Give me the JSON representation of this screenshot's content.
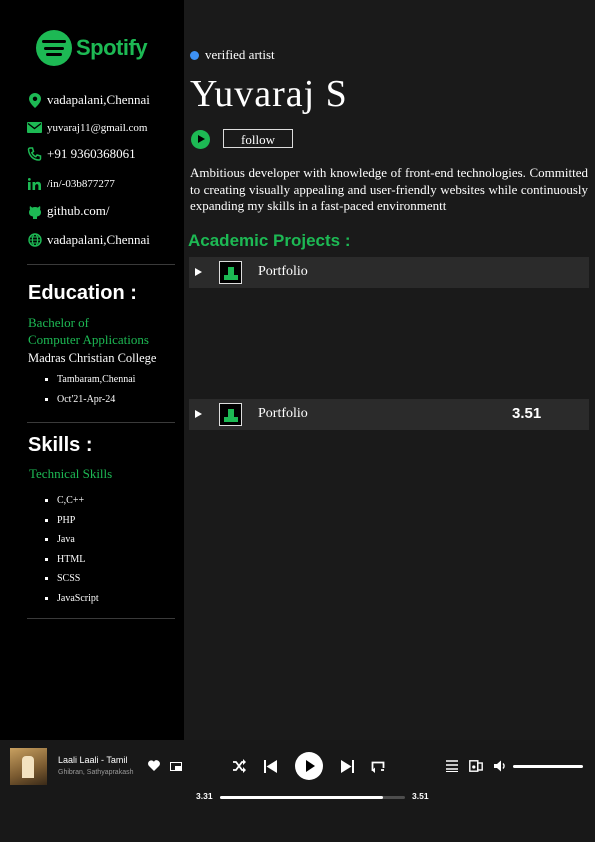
{
  "sidebar": {
    "logo_text": "Spotify",
    "contacts": [
      {
        "icon": "location-pin-icon",
        "text": "vadapalani,Chennai"
      },
      {
        "icon": "mail-icon",
        "text": "yuvaraj11@gmail.com"
      },
      {
        "icon": "phone-icon",
        "text": "+91 9360368061"
      },
      {
        "icon": "linkedin-icon",
        "text": "/in/-03b877277"
      },
      {
        "icon": "github-icon",
        "text": "github.com/"
      },
      {
        "icon": "globe-icon",
        "text": "vadapalani,Chennai"
      }
    ],
    "education": {
      "title": "Education :",
      "degree_line1": "Bachelor of",
      "degree_line2": "Computer Applications",
      "college": "Madras Christian College",
      "details": [
        "Tambaram,Chennai",
        "Oct'21-Apr-24"
      ]
    },
    "skills": {
      "title": "Skills :",
      "subtitle": "Technical Skills",
      "items": [
        "C,C++",
        "PHP",
        "Java",
        "HTML",
        "SCSS",
        "JavaScript"
      ]
    }
  },
  "main": {
    "verified_label": "verified artist",
    "name": "Yuvaraj S",
    "follow_label": "follow",
    "bio": "Ambitious developer with  knowledge of  front-end technologies. Committed to creating visually  appealing and user-friendly websites while continuously expanding my  skills in a fast-paced environmentt",
    "projects_title": "Academic Projects :",
    "projects": [
      {
        "label": "Portfolio",
        "duration": ""
      },
      {
        "label": "Portfolio",
        "duration": "3.51"
      }
    ]
  },
  "player": {
    "song": "Laali Laali - Tamil",
    "artist": "Ghibran, Sathyaprakash",
    "current_time": "3.31",
    "total_time": "3.51",
    "progress": 0.88,
    "volume": 1.0,
    "colors": {
      "accent": "#1db954",
      "background": "#181818"
    }
  }
}
